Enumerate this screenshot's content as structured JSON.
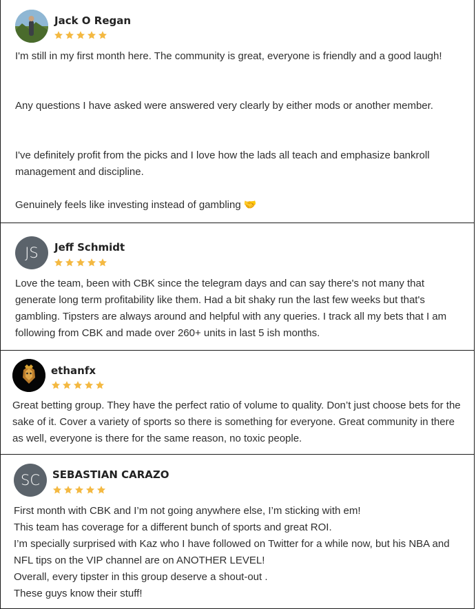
{
  "star_color": "#f4b942",
  "reviews": [
    {
      "name": "Jack O Regan",
      "avatar": {
        "type": "photo",
        "icon": "landscape-photo-avatar"
      },
      "rating": 5,
      "paragraphs": [
        "I'm still in my first month here. The community is great, everyone is friendly and a good laugh!",
        "Any questions I have asked were answered very clearly by either mods or another member.",
        "I've definitely profit from the picks and I love how the lads all teach and emphasize bankroll management and discipline.",
        "Genuinely feels like investing instead of gambling 🤝"
      ]
    },
    {
      "name": "Jeff Schmidt",
      "avatar": {
        "type": "initials",
        "initials": "JS"
      },
      "rating": 5,
      "paragraphs": [
        "Love the team, been with CBK since the telegram days and can say there's not many that generate long term profitability like them. Had a bit shaky run the last few weeks but that's gambling. Tipsters are always around and helpful with any queries. I track all my bets that I am following from CBK and made over 260+ units in last 5 ish months."
      ]
    },
    {
      "name": "ethanfx",
      "avatar": {
        "type": "logo",
        "icon": "lion-logo-avatar"
      },
      "rating": 5,
      "paragraphs": [
        "Great betting group. They have the perfect ratio of volume to quality. Don’t just choose bets for the sake of it. Cover a variety of sports so there is something for everyone. Great community in there as well, everyone is there for the same reason, no toxic people."
      ]
    },
    {
      "name": "SEBASTIAN CARAZO",
      "avatar": {
        "type": "initials",
        "initials": "SC"
      },
      "rating": 5,
      "paragraphs": [
        "First month with CBK and I’m not going anywhere else, I’m sticking with em!",
        "This team has coverage for a different bunch of sports and great ROI.",
        "I’m specially surprised with Kaz who I have followed on Twitter for a while now, but his NBA and NFL tips on the VIP channel are on ANOTHER LEVEL!",
        "Overall, every tipster in this group deserve a shout-out .",
        "These guys know their stuff!"
      ]
    }
  ]
}
